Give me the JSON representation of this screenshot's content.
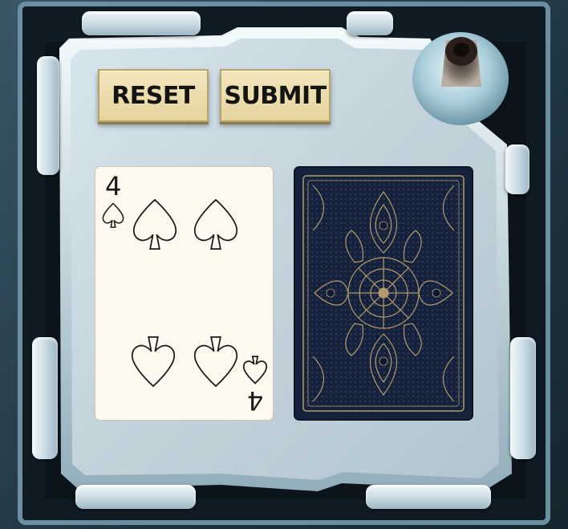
{
  "buttons": {
    "reset_label": "RESET",
    "submit_label": "SUBMIT"
  },
  "cards": {
    "face_up": {
      "rank": "4",
      "suit": "spades",
      "suit_icon": "spade-icon"
    },
    "face_down": {
      "design": "ornate-card-back"
    }
  },
  "colors": {
    "button_face": "#efe1b4",
    "panel": "#c9d9e1",
    "card_face": "#fdf9ee",
    "card_back": "#16223c",
    "card_back_ornament": "#b39a6c"
  }
}
